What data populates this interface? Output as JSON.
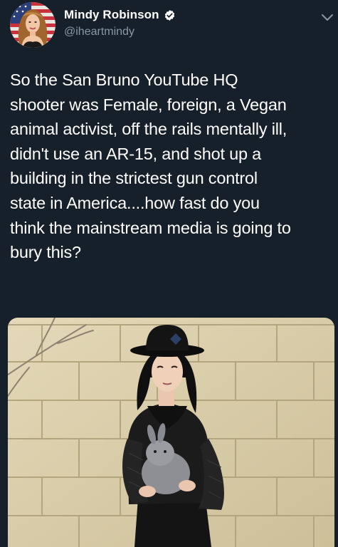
{
  "author": {
    "display_name": "Mindy Robinson",
    "handle": "@iheartmindy",
    "verified": true,
    "avatar_icon": "profile-photo",
    "verified_icon": "verified-badge-icon",
    "menu_icon": "chevron-down-icon"
  },
  "tweet": {
    "lines": [
      "So the San Bruno YouTube HQ",
      "shooter was Female, foreign, a Vegan",
      "animal activist, off the rails mentally ill,",
      "didn't use an AR-15, and shot up a",
      "building in the strictest gun control",
      "state in America....how fast do you",
      "think the mainstream media is going to",
      "bury this?"
    ]
  },
  "media": {
    "type": "photo"
  },
  "colors": {
    "background": "#16202b",
    "text": "#ffffff",
    "handle": "#8899a6",
    "verified_fill": "#ffffff",
    "verified_check": "#16202b"
  }
}
